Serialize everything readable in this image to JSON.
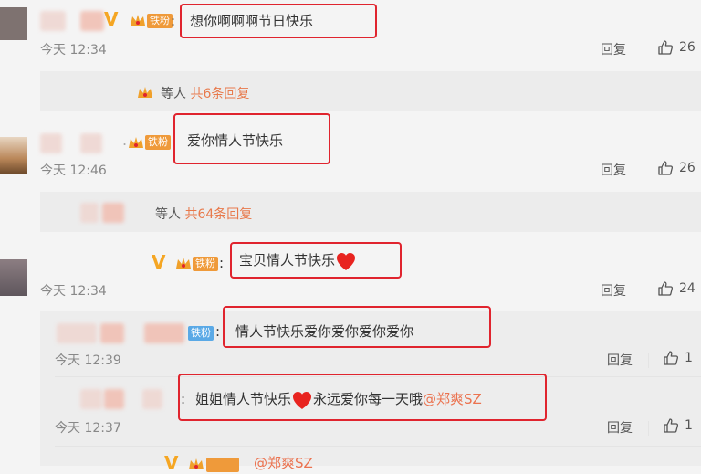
{
  "comments": [
    {
      "text": "想你啊啊啊节日快乐",
      "time": "今天 12:34",
      "reply_label": "回复",
      "likes": "26",
      "fan_badge": "铁粉",
      "sub_prefix": "等人",
      "sub_count": "共6条回复"
    },
    {
      "text": "爱你情人节快乐",
      "time": "今天 12:46",
      "reply_label": "回复",
      "likes": "26",
      "fan_badge": "铁粉",
      "sub_prefix": "等人",
      "sub_count": "共64条回复"
    },
    {
      "text": "宝贝情人节快乐",
      "time": "今天 12:34",
      "reply_label": "回复",
      "likes": "24",
      "fan_badge": "铁粉",
      "replies": [
        {
          "text": "情人节快乐爱你爱你爱你爱你",
          "time": "今天 12:39",
          "reply_label": "回复",
          "likes": "1",
          "fan_badge": "铁粉"
        },
        {
          "text_a": "姐姐情人节快乐",
          "text_b": "永远爱你每一天哦",
          "mention": "@郑爽SZ",
          "time": "今天 12:37",
          "reply_label": "回复",
          "likes": "1"
        }
      ],
      "partial_next": "@郑爽SZ"
    }
  ],
  "colors": {
    "highlight_box": "#e0242e",
    "badge_orange": "#ef9a3a",
    "badge_blue": "#5aa9e6",
    "link": "#e8794b"
  }
}
